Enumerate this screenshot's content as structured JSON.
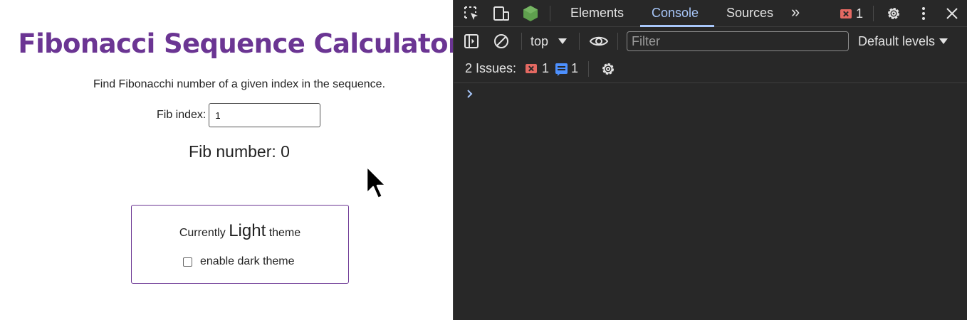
{
  "app": {
    "title": "Fibonacci Sequence Calculator",
    "description": "Find Fibonacchi number of a given index in the sequence.",
    "fib_index_label": "Fib index:",
    "fib_index_value": "1",
    "fib_result": "Fib number: 0",
    "theme": {
      "prefix": "Currently",
      "current": "Light",
      "suffix": "theme",
      "dark_toggle_label": "enable dark theme",
      "dark_enabled": false
    },
    "colors": {
      "accent": "#6b3593",
      "text": "#222222",
      "background": "#ffffff"
    }
  },
  "devtools": {
    "tabs": [
      {
        "label": "Elements",
        "active": false
      },
      {
        "label": "Console",
        "active": true
      },
      {
        "label": "Sources",
        "active": false
      }
    ],
    "more_tabs_glyph": "»",
    "error_count": "1",
    "toolbar": {
      "context": "top",
      "filter_placeholder": "Filter",
      "levels": "Default levels"
    },
    "issues": {
      "label": "2 Issues:",
      "errors": "1",
      "messages": "1"
    },
    "colors": {
      "background": "#282828",
      "text": "#e3e3e3",
      "active": "#a8c7fa",
      "error": "#e46962",
      "info": "#4d90fe"
    },
    "icons": [
      "inspect-element-icon",
      "device-toolbar-icon",
      "node-icon",
      "more-tabs-icon",
      "error-icon",
      "settings-gear-icon",
      "kebab-menu-icon",
      "close-icon",
      "sidebar-toggle-icon",
      "clear-console-icon",
      "eye-icon",
      "message-icon",
      "issues-settings-icon",
      "console-prompt-chevron-icon"
    ]
  }
}
